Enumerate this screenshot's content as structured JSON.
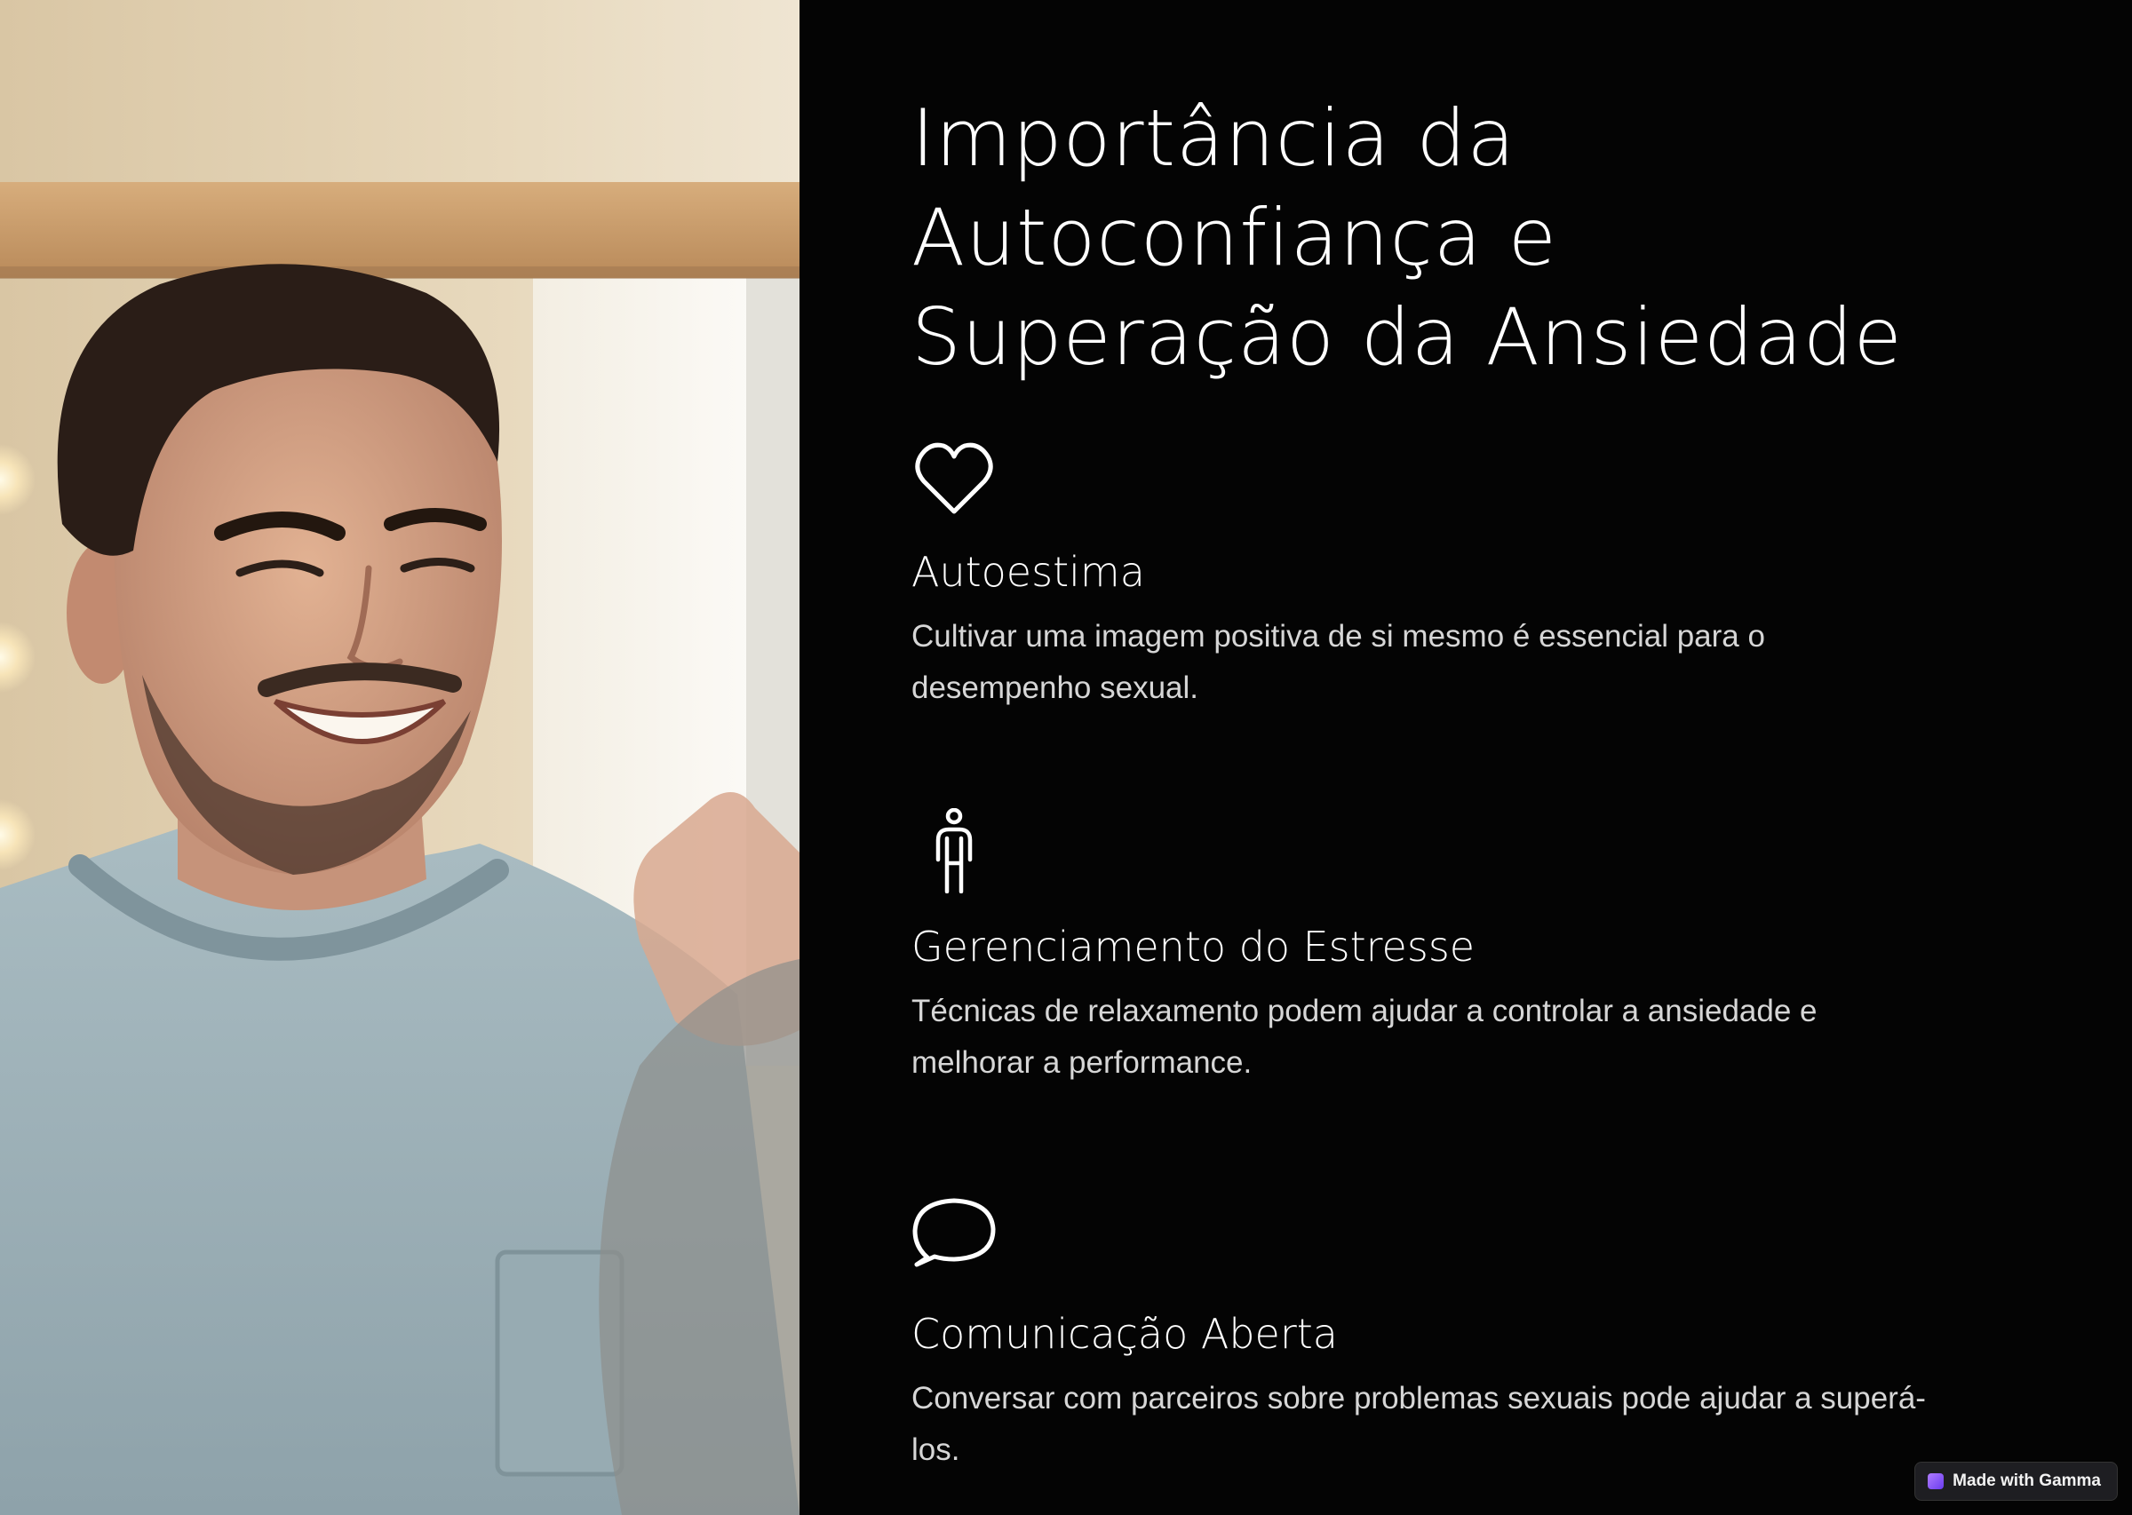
{
  "slide": {
    "title": "Importância da Autoconfiança e Superação da Ansiedade",
    "title_lines": [
      "Importância da",
      "Autoconfiança e",
      "Superação da Ansiedade"
    ]
  },
  "features": [
    {
      "icon": "heart-icon",
      "heading": "Autoestima",
      "text": "Cultivar uma imagem positiva de si mesmo é essencial para o desempenho sexual."
    },
    {
      "icon": "person-icon",
      "heading": "Gerenciamento do Estresse",
      "text": "Técnicas de relaxamento podem ajudar a controlar a ansiedade e melhorar a performance."
    },
    {
      "icon": "speech-bubble-icon",
      "heading": "Comunicação Aberta",
      "text": "Conversar com parceiros sobre problemas sexuais pode ajudar a superá-los."
    }
  ],
  "badge": {
    "label": "Made with Gamma"
  },
  "colors": {
    "background": "#040404",
    "text": "#ffffff",
    "body_text": "#d6d6d6"
  }
}
